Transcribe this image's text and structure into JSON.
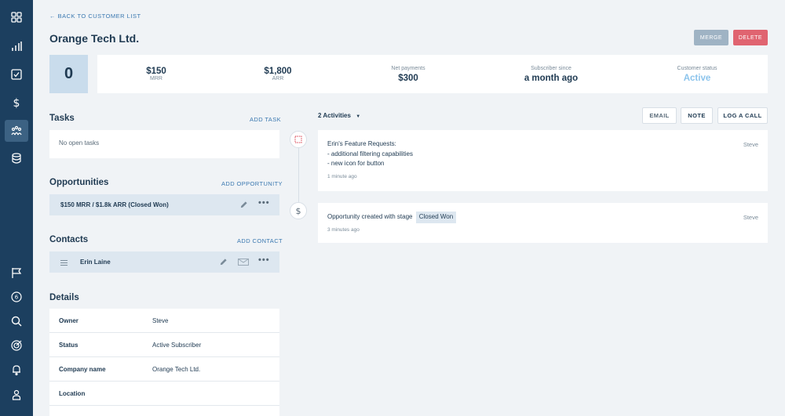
{
  "sidebar": {
    "icons": [
      "grid-icon",
      "chart-icon",
      "checkbox-icon",
      "dollar-icon",
      "customers-icon",
      "database-icon",
      "flag-icon",
      "notification-count-icon",
      "search-icon",
      "target-icon",
      "bell-icon",
      "user-icon"
    ],
    "notification_count": "6"
  },
  "header": {
    "back_label": "← BACK TO CUSTOMER LIST",
    "title": "Orange Tech Ltd.",
    "merge_label": "MERGE",
    "delete_label": "DELETE"
  },
  "summary": {
    "avatar_count": "0",
    "mrr_value": "$150",
    "mrr_label": "MRR",
    "arr_value": "$1,800",
    "arr_label": "ARR",
    "net_label": "Net payments",
    "net_value": "$300",
    "since_label": "Subscriber since",
    "since_value": "a month ago",
    "status_label": "Customer status",
    "status_value": "Active"
  },
  "tasks": {
    "title": "Tasks",
    "add_label": "ADD TASK",
    "empty_text": "No open tasks"
  },
  "opportunities": {
    "title": "Opportunities",
    "add_label": "ADD OPPORTUNITY",
    "item_amount": "$150 MRR / $1.8k ARR",
    "item_stage": "(Closed Won)"
  },
  "contacts": {
    "title": "Contacts",
    "add_label": "ADD CONTACT",
    "item_name": "Erin Laine"
  },
  "details": {
    "title": "Details",
    "rows": [
      {
        "key": "Owner",
        "value": "Steve"
      },
      {
        "key": "Status",
        "value": "Active Subscriber"
      },
      {
        "key": "Company name",
        "value": "Orange Tech Ltd."
      },
      {
        "key": "Location",
        "value": ""
      }
    ]
  },
  "activities": {
    "count_label": "2 Activities",
    "email_label": "EMAIL",
    "note_label": "NOTE",
    "call_label": "LOG A CALL",
    "items": [
      {
        "lines": [
          "Erin's Feature Requests:",
          "- additional filtering capabilities",
          "- new icon for button"
        ],
        "author": "Steve",
        "time": "1 minute ago"
      },
      {
        "text": "Opportunity created with stage",
        "stage": "Closed Won",
        "author": "Steve",
        "time": "3 minutes ago"
      }
    ]
  },
  "colors": {
    "sidebar": "#1c3f5f",
    "link": "#3a78b0",
    "delete": "#e06470",
    "merge": "#9fb3c4",
    "active_status": "#8cc4ec"
  }
}
